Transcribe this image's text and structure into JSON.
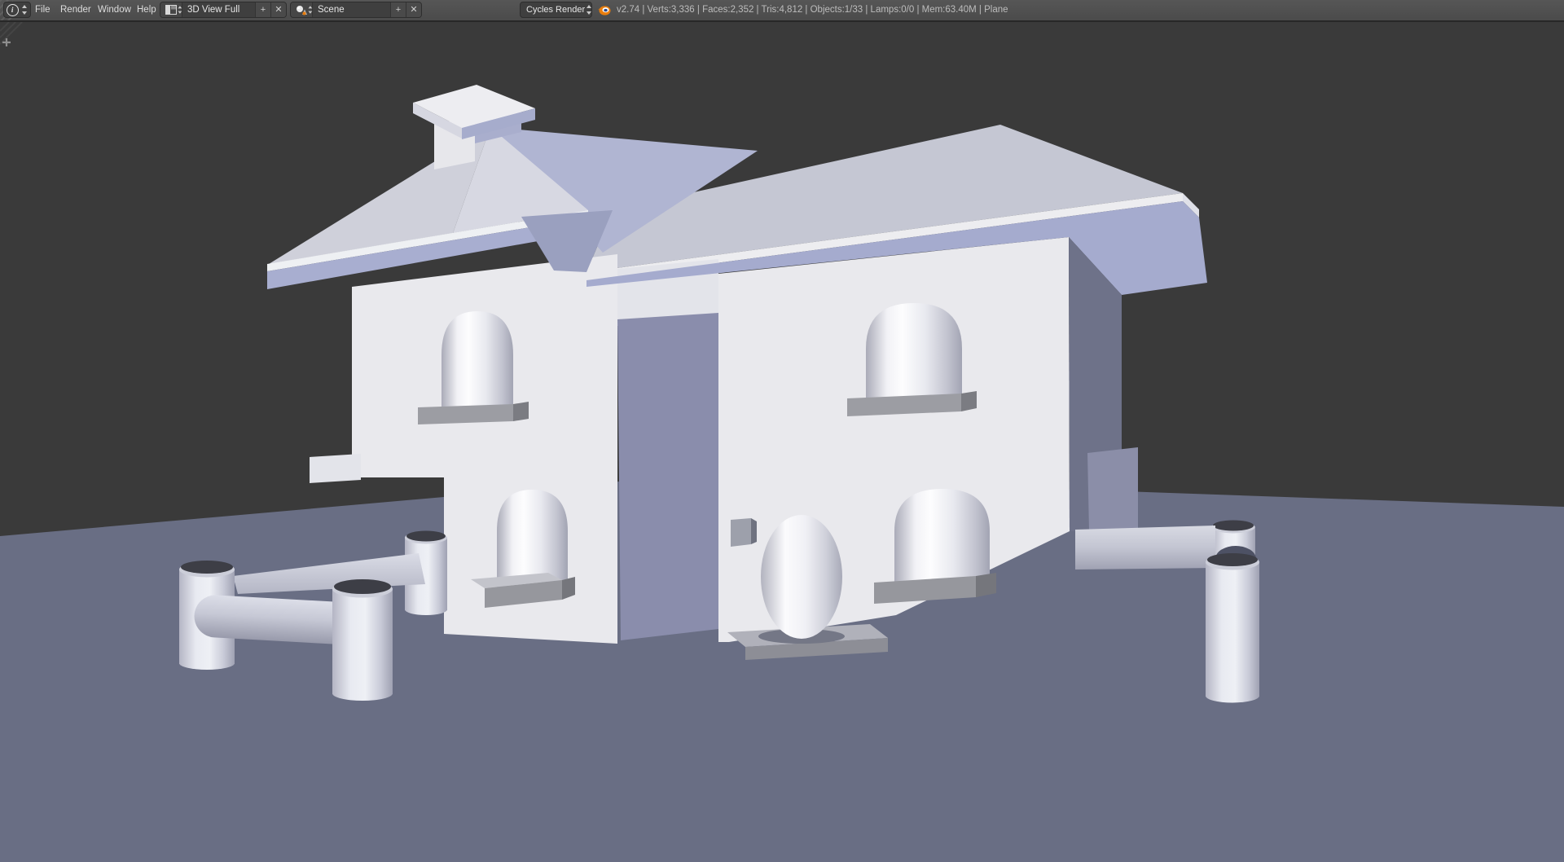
{
  "header": {
    "menus": [
      {
        "label": "File"
      },
      {
        "label": "Render"
      },
      {
        "label": "Window"
      },
      {
        "label": "Help"
      }
    ],
    "screen_layout": {
      "value": "3D View Full",
      "add_label": "+",
      "close_label": "✕"
    },
    "scene_selector": {
      "value": "Scene",
      "add_label": "+",
      "close_label": "✕"
    },
    "render_engine": {
      "value": "Cycles Render"
    },
    "stats": "v2.74 | Verts:3,336 | Faces:2,352 | Tris:4,812 | Objects:1/33 | Lamps:0/0 | Mem:63.40M | Plane"
  },
  "viewport": {
    "colors": {
      "background": "#3a3a3a",
      "ground": "#696e84",
      "wall": "#e9e9ed",
      "roof_light": "#d3d4de",
      "roof_slope_right": "#c5c7d3",
      "roof_shadow_face": "#b0b5d2",
      "soffit": "#a8aed0",
      "fascia": "#eeeef2",
      "connector_shadow": "#8a8dac",
      "side_wall_shadow": "#6e7289",
      "sill_gray": "#9c9da3",
      "header_bg": "#4f4f4f",
      "logo_orange": "#e87d0d"
    }
  }
}
